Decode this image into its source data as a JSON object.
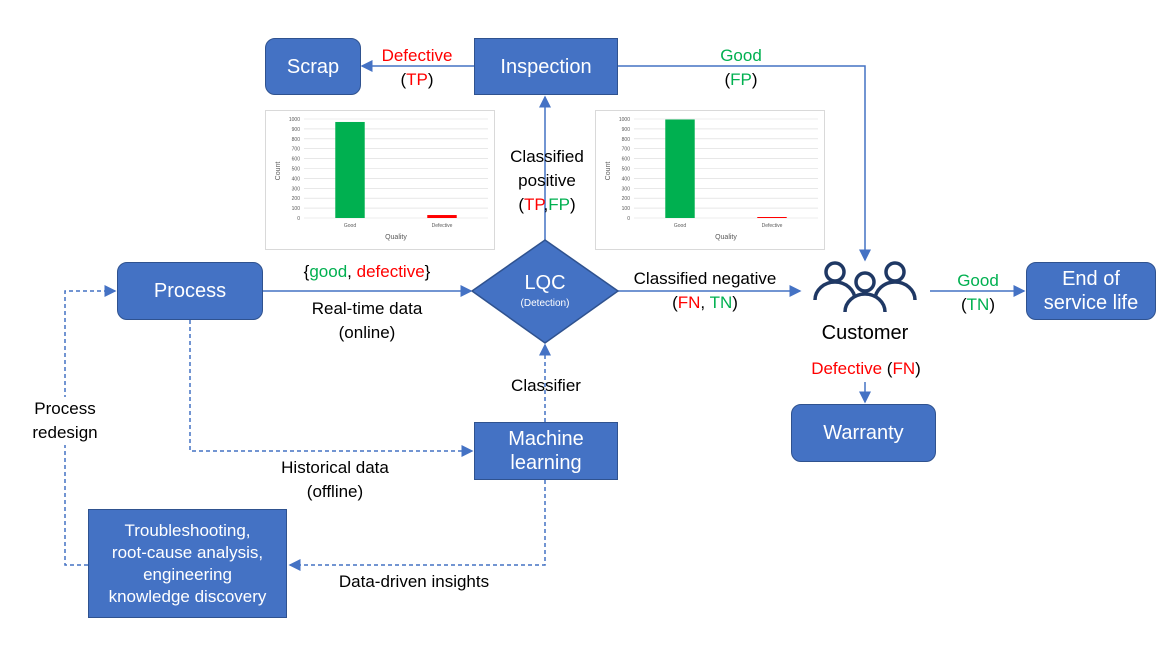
{
  "colors": {
    "box": "#4472C4",
    "border": "#2F528F",
    "arrow": "#4472C4",
    "positive": "#FF0000",
    "negative": "#00B050"
  },
  "nodes": {
    "scrap": "Scrap",
    "inspection": "Inspection",
    "process": "Process",
    "lqc": "LQC",
    "lqc_sub": "(Detection)",
    "customer": "Customer",
    "end_of_life_1": "End of",
    "end_of_life_2": "service life",
    "warranty": "Warranty",
    "ml_1": "Machine",
    "ml_2": "learning",
    "trouble_1": "Troubleshooting,",
    "trouble_2": "root-cause analysis,",
    "trouble_3": "engineering",
    "trouble_4": "knowledge discovery"
  },
  "labels": {
    "defective": "Defective",
    "tp": "TP",
    "good": "Good",
    "fp": "FP",
    "classified_positive_1": "Classified",
    "classified_positive_2": "positive",
    "classes_good": "good",
    "classes_defective": "defective",
    "realtime_1": "Real-time data",
    "realtime_2": "(online)",
    "classified_negative": "Classified negative",
    "fn": "FN",
    "tn": "TN",
    "classifier": "Classifier",
    "historical_1": "Historical data",
    "historical_2": "(offline)",
    "insights": "Data-driven insights",
    "redesign_1": "Process",
    "redesign_2": "redesign"
  },
  "chart_data": [
    {
      "type": "bar",
      "categories": [
        "Good",
        "Defective"
      ],
      "values": [
        970,
        30
      ],
      "colors": [
        "#00B050",
        "#FF0000"
      ],
      "xlabel": "Quality",
      "ylabel": "Count",
      "ylim": [
        0,
        1000
      ],
      "yticks": [
        0,
        100,
        200,
        300,
        400,
        500,
        600,
        700,
        800,
        900,
        1000
      ],
      "grid": true
    },
    {
      "type": "bar",
      "categories": [
        "Good",
        "Defective"
      ],
      "values": [
        995,
        5
      ],
      "colors": [
        "#00B050",
        "#FF0000"
      ],
      "xlabel": "Quality",
      "ylabel": "Count",
      "ylim": [
        0,
        1000
      ],
      "yticks": [
        0,
        100,
        200,
        300,
        400,
        500,
        600,
        700,
        800,
        900,
        1000
      ],
      "grid": true
    }
  ]
}
